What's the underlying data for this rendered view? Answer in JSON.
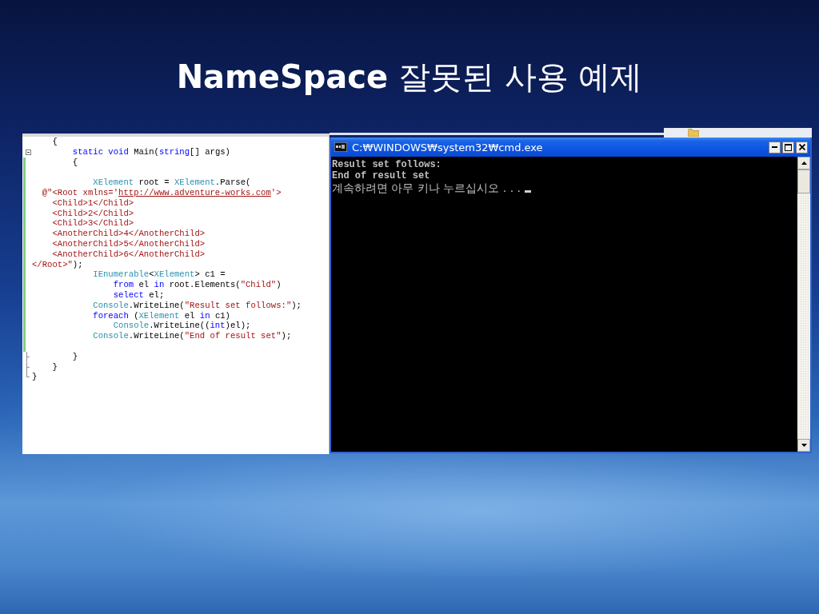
{
  "slide": {
    "title": "**NameSpace** 잘못된 사용 예제"
  },
  "code_editor": {
    "lines": [
      {
        "changed": false,
        "block_end": false,
        "tokens": [
          {
            "kind": "plain",
            "text": "    {"
          }
        ]
      },
      {
        "changed": false,
        "block_end": false,
        "expanded": true,
        "tokens": [
          {
            "kind": "keyword",
            "text": "        static void"
          },
          {
            "kind": "plain",
            "text": " Main("
          },
          {
            "kind": "keyword",
            "text": "string"
          },
          {
            "kind": "plain",
            "text": "[] args)"
          }
        ]
      },
      {
        "changed": true,
        "block_end": false,
        "tokens": [
          {
            "kind": "plain",
            "text": "        {"
          }
        ]
      },
      {
        "changed": true,
        "block_end": false
      },
      {
        "changed": true,
        "block_end": false,
        "tokens": [
          {
            "kind": "type",
            "text": "            XElement"
          },
          {
            "kind": "plain",
            "text": " root = "
          },
          {
            "kind": "type",
            "text": "XElement"
          },
          {
            "kind": "plain",
            "text": ".Parse("
          }
        ]
      },
      {
        "changed": true,
        "block_end": false,
        "tokens": [
          {
            "kind": "string",
            "text": "  @\"<Root xmlns='"
          },
          {
            "kind": "link",
            "text": "http://www.adventure-works.com"
          },
          {
            "kind": "string",
            "text": "'>"
          }
        ]
      },
      {
        "changed": true,
        "block_end": false,
        "tokens": [
          {
            "kind": "string",
            "text": "    <Child>1</Child>"
          }
        ]
      },
      {
        "changed": true,
        "block_end": false,
        "tokens": [
          {
            "kind": "string",
            "text": "    <Child>2</Child>"
          }
        ]
      },
      {
        "changed": true,
        "block_end": false,
        "tokens": [
          {
            "kind": "string",
            "text": "    <Child>3</Child>"
          }
        ]
      },
      {
        "changed": true,
        "block_end": false,
        "tokens": [
          {
            "kind": "string",
            "text": "    <AnotherChild>4</AnotherChild>"
          }
        ]
      },
      {
        "changed": true,
        "block_end": false,
        "tokens": [
          {
            "kind": "string",
            "text": "    <AnotherChild>5</AnotherChild>"
          }
        ]
      },
      {
        "changed": true,
        "block_end": false,
        "tokens": [
          {
            "kind": "string",
            "text": "    <AnotherChild>6</AnotherChild>"
          }
        ]
      },
      {
        "changed": true,
        "block_end": false,
        "tokens": [
          {
            "kind": "string",
            "text": "</Root>\""
          },
          {
            "kind": "plain",
            "text": ");"
          }
        ]
      },
      {
        "changed": true,
        "block_end": false,
        "tokens": [
          {
            "kind": "type",
            "text": "            IEnumerable"
          },
          {
            "kind": "plain",
            "text": "<"
          },
          {
            "kind": "type",
            "text": "XElement"
          },
          {
            "kind": "plain",
            "text": "> c1 ="
          }
        ]
      },
      {
        "changed": true,
        "block_end": false,
        "tokens": [
          {
            "kind": "keyword",
            "text": "                from"
          },
          {
            "kind": "plain",
            "text": " el "
          },
          {
            "kind": "keyword",
            "text": "in"
          },
          {
            "kind": "plain",
            "text": " root.Elements("
          },
          {
            "kind": "string",
            "text": "\"Child\""
          },
          {
            "kind": "plain",
            "text": ")"
          }
        ]
      },
      {
        "changed": true,
        "block_end": false,
        "tokens": [
          {
            "kind": "keyword",
            "text": "                select"
          },
          {
            "kind": "plain",
            "text": " el;"
          }
        ]
      },
      {
        "changed": true,
        "block_end": false,
        "tokens": [
          {
            "kind": "type",
            "text": "            Console"
          },
          {
            "kind": "plain",
            "text": ".WriteLine("
          },
          {
            "kind": "string",
            "text": "\"Result set follows:\""
          },
          {
            "kind": "plain",
            "text": ");"
          }
        ]
      },
      {
        "changed": true,
        "block_end": false,
        "tokens": [
          {
            "kind": "keyword",
            "text": "            foreach"
          },
          {
            "kind": "plain",
            "text": " ("
          },
          {
            "kind": "type",
            "text": "XElement"
          },
          {
            "kind": "plain",
            "text": " el "
          },
          {
            "kind": "keyword",
            "text": "in"
          },
          {
            "kind": "plain",
            "text": " c1)"
          }
        ]
      },
      {
        "changed": true,
        "block_end": false,
        "tokens": [
          {
            "kind": "type",
            "text": "                Console"
          },
          {
            "kind": "plain",
            "text": ".WriteLine(("
          },
          {
            "kind": "keyword",
            "text": "int"
          },
          {
            "kind": "plain",
            "text": ")el);"
          }
        ]
      },
      {
        "changed": true,
        "block_end": false,
        "tokens": [
          {
            "kind": "type",
            "text": "            Console"
          },
          {
            "kind": "plain",
            "text": ".WriteLine("
          },
          {
            "kind": "string",
            "text": "\"End of result set\""
          },
          {
            "kind": "plain",
            "text": ");"
          }
        ]
      },
      {
        "changed": true,
        "block_end": false
      },
      {
        "changed": false,
        "block_end": true,
        "tokens": [
          {
            "kind": "plain",
            "text": "        }"
          }
        ]
      },
      {
        "changed": false,
        "block_end": true,
        "tokens": [
          {
            "kind": "plain",
            "text": "    }"
          }
        ]
      },
      {
        "changed": false,
        "block_end": true,
        "tokens": [
          {
            "kind": "plain",
            "text": "}"
          }
        ]
      }
    ]
  },
  "console_window": {
    "title": "C:₩WINDOWS₩system32₩cmd.exe",
    "output": [
      {
        "kind": "result",
        "text": "Result set follows:",
        "cursor": false
      },
      {
        "kind": "result",
        "text": "End of result set",
        "cursor": false
      },
      {
        "kind": "prompt",
        "text": "계속하려면 아무 키나 누르십시오 . . .",
        "cursor": true
      }
    ]
  }
}
